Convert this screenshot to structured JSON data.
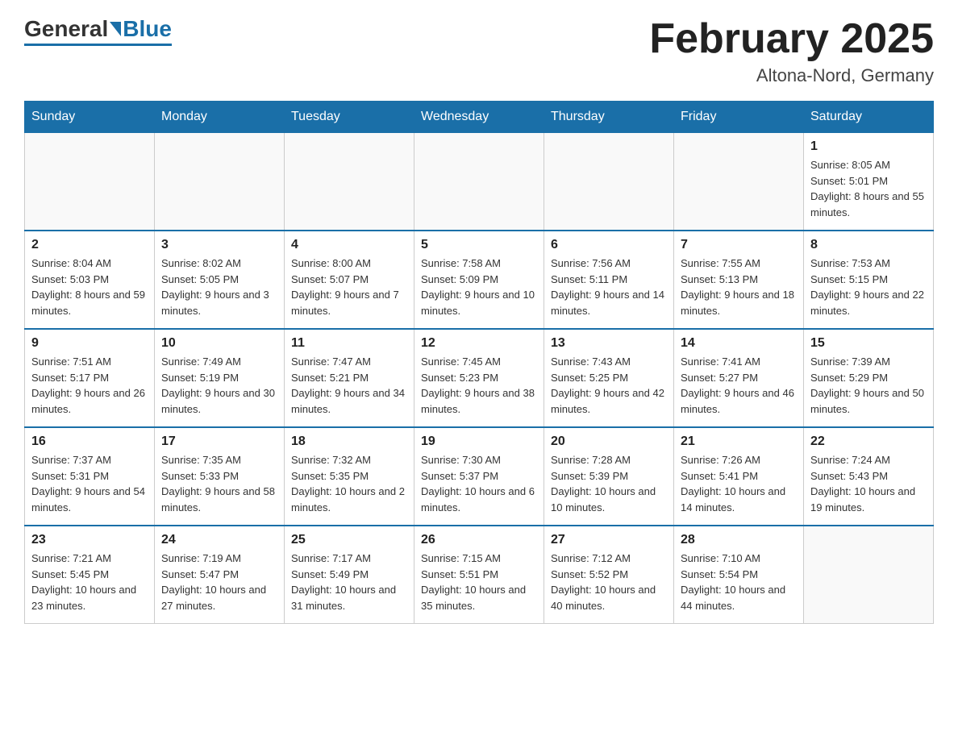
{
  "header": {
    "logo": {
      "general": "General",
      "blue": "Blue"
    },
    "title": "February 2025",
    "location": "Altona-Nord, Germany"
  },
  "weekdays": [
    "Sunday",
    "Monday",
    "Tuesday",
    "Wednesday",
    "Thursday",
    "Friday",
    "Saturday"
  ],
  "weeks": [
    [
      {
        "day": "",
        "info": ""
      },
      {
        "day": "",
        "info": ""
      },
      {
        "day": "",
        "info": ""
      },
      {
        "day": "",
        "info": ""
      },
      {
        "day": "",
        "info": ""
      },
      {
        "day": "",
        "info": ""
      },
      {
        "day": "1",
        "info": "Sunrise: 8:05 AM\nSunset: 5:01 PM\nDaylight: 8 hours and 55 minutes."
      }
    ],
    [
      {
        "day": "2",
        "info": "Sunrise: 8:04 AM\nSunset: 5:03 PM\nDaylight: 8 hours and 59 minutes."
      },
      {
        "day": "3",
        "info": "Sunrise: 8:02 AM\nSunset: 5:05 PM\nDaylight: 9 hours and 3 minutes."
      },
      {
        "day": "4",
        "info": "Sunrise: 8:00 AM\nSunset: 5:07 PM\nDaylight: 9 hours and 7 minutes."
      },
      {
        "day": "5",
        "info": "Sunrise: 7:58 AM\nSunset: 5:09 PM\nDaylight: 9 hours and 10 minutes."
      },
      {
        "day": "6",
        "info": "Sunrise: 7:56 AM\nSunset: 5:11 PM\nDaylight: 9 hours and 14 minutes."
      },
      {
        "day": "7",
        "info": "Sunrise: 7:55 AM\nSunset: 5:13 PM\nDaylight: 9 hours and 18 minutes."
      },
      {
        "day": "8",
        "info": "Sunrise: 7:53 AM\nSunset: 5:15 PM\nDaylight: 9 hours and 22 minutes."
      }
    ],
    [
      {
        "day": "9",
        "info": "Sunrise: 7:51 AM\nSunset: 5:17 PM\nDaylight: 9 hours and 26 minutes."
      },
      {
        "day": "10",
        "info": "Sunrise: 7:49 AM\nSunset: 5:19 PM\nDaylight: 9 hours and 30 minutes."
      },
      {
        "day": "11",
        "info": "Sunrise: 7:47 AM\nSunset: 5:21 PM\nDaylight: 9 hours and 34 minutes."
      },
      {
        "day": "12",
        "info": "Sunrise: 7:45 AM\nSunset: 5:23 PM\nDaylight: 9 hours and 38 minutes."
      },
      {
        "day": "13",
        "info": "Sunrise: 7:43 AM\nSunset: 5:25 PM\nDaylight: 9 hours and 42 minutes."
      },
      {
        "day": "14",
        "info": "Sunrise: 7:41 AM\nSunset: 5:27 PM\nDaylight: 9 hours and 46 minutes."
      },
      {
        "day": "15",
        "info": "Sunrise: 7:39 AM\nSunset: 5:29 PM\nDaylight: 9 hours and 50 minutes."
      }
    ],
    [
      {
        "day": "16",
        "info": "Sunrise: 7:37 AM\nSunset: 5:31 PM\nDaylight: 9 hours and 54 minutes."
      },
      {
        "day": "17",
        "info": "Sunrise: 7:35 AM\nSunset: 5:33 PM\nDaylight: 9 hours and 58 minutes."
      },
      {
        "day": "18",
        "info": "Sunrise: 7:32 AM\nSunset: 5:35 PM\nDaylight: 10 hours and 2 minutes."
      },
      {
        "day": "19",
        "info": "Sunrise: 7:30 AM\nSunset: 5:37 PM\nDaylight: 10 hours and 6 minutes."
      },
      {
        "day": "20",
        "info": "Sunrise: 7:28 AM\nSunset: 5:39 PM\nDaylight: 10 hours and 10 minutes."
      },
      {
        "day": "21",
        "info": "Sunrise: 7:26 AM\nSunset: 5:41 PM\nDaylight: 10 hours and 14 minutes."
      },
      {
        "day": "22",
        "info": "Sunrise: 7:24 AM\nSunset: 5:43 PM\nDaylight: 10 hours and 19 minutes."
      }
    ],
    [
      {
        "day": "23",
        "info": "Sunrise: 7:21 AM\nSunset: 5:45 PM\nDaylight: 10 hours and 23 minutes."
      },
      {
        "day": "24",
        "info": "Sunrise: 7:19 AM\nSunset: 5:47 PM\nDaylight: 10 hours and 27 minutes."
      },
      {
        "day": "25",
        "info": "Sunrise: 7:17 AM\nSunset: 5:49 PM\nDaylight: 10 hours and 31 minutes."
      },
      {
        "day": "26",
        "info": "Sunrise: 7:15 AM\nSunset: 5:51 PM\nDaylight: 10 hours and 35 minutes."
      },
      {
        "day": "27",
        "info": "Sunrise: 7:12 AM\nSunset: 5:52 PM\nDaylight: 10 hours and 40 minutes."
      },
      {
        "day": "28",
        "info": "Sunrise: 7:10 AM\nSunset: 5:54 PM\nDaylight: 10 hours and 44 minutes."
      },
      {
        "day": "",
        "info": ""
      }
    ]
  ]
}
